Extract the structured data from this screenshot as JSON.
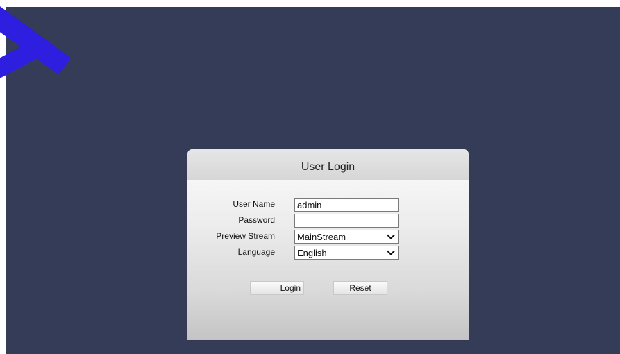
{
  "login": {
    "title": "User Login",
    "fields": {
      "username": {
        "label": "User Name",
        "value": "admin"
      },
      "password": {
        "label": "Password",
        "value": ""
      },
      "preview_stream": {
        "label": "Preview Stream",
        "value": "MainStream"
      },
      "language": {
        "label": "Language",
        "value": "English"
      }
    },
    "buttons": {
      "login": "Login",
      "reset": "Reset"
    }
  },
  "colors": {
    "background": "#343c58",
    "watermark": "#2d1ee0",
    "panel_header": "#dcdcdc"
  },
  "icons": {
    "select_arrow": "chevron-down-icon"
  }
}
